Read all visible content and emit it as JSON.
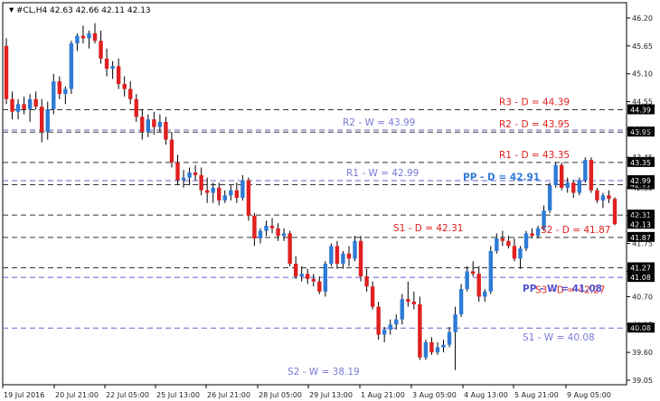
{
  "header": {
    "symbol": "#CL,H4",
    "ohlc": "42.63 42.66 42.11 42.13"
  },
  "colors": {
    "bull": "#2e7bd6",
    "bear": "#e02020",
    "daily_line": "#333333",
    "weekly_line": "#6666cc",
    "daily_label": "#e02020",
    "weekly_label": "#7a7ad8",
    "pp_daily": "#2e7bd6",
    "pp_weekly": "#5050d0"
  },
  "chart_data": {
    "type": "candlestick",
    "ylim": [
      39.05,
      46.3
    ],
    "y_ticks": [
      "46.20",
      "45.65",
      "45.10",
      "44.55",
      "44.00",
      "43.45",
      "42.85",
      "42.30",
      "41.75",
      "41.20",
      "40.70",
      "40.15",
      "39.60",
      "39.05"
    ],
    "x_ticks": [
      "19 Jul 2016",
      "20 Jul 21:00",
      "22 Jul 05:00",
      "25 Jul 13:00",
      "26 Jul 21:00",
      "28 Jul 05:00",
      "29 Jul 13:00",
      "1 Aug 21:00",
      "3 Aug 05:00",
      "4 Aug 13:00",
      "5 Aug 21:00",
      "9 Aug 05:00"
    ],
    "levels": [
      {
        "label": "R3 - D = 44.39",
        "value": 44.39,
        "kind": "daily",
        "tag": "44.39"
      },
      {
        "label": "R2 - D = 43.95",
        "value": 43.95,
        "kind": "daily",
        "tag": "43.95"
      },
      {
        "label": "R1 - D = 43.35",
        "value": 43.35,
        "kind": "daily",
        "tag": "43.35"
      },
      {
        "label": "PP - D = 42.91",
        "value": 42.91,
        "kind": "pp_daily",
        "tag": "42.91"
      },
      {
        "label": "S1 - D = 42.31",
        "value": 42.31,
        "kind": "daily",
        "tag": "42.31"
      },
      {
        "label": "S2 - D = 41.87",
        "value": 41.87,
        "kind": "daily",
        "tag": "41.87"
      },
      {
        "label": "S3 - D = 42.27",
        "value": 41.27,
        "kind": "daily",
        "tag": "41.27"
      },
      {
        "label": "R2 - W = 43.99",
        "value": 43.99,
        "kind": "weekly",
        "tag": null
      },
      {
        "label": "R1 - W = 42.99",
        "value": 42.99,
        "kind": "weekly",
        "tag": "42.99"
      },
      {
        "label": "PP - W = 41.08",
        "value": 41.08,
        "kind": "pp_weekly",
        "tag": "41.08"
      },
      {
        "label": "S1 - W = 40.08",
        "value": 40.08,
        "kind": "weekly",
        "tag": "40.08"
      },
      {
        "label": "S2 - W = 38.19",
        "value": 38.19,
        "kind": "weekly",
        "tag": null
      }
    ],
    "current_price": "42.13",
    "candles": [
      [
        45.65,
        45.8,
        44.5,
        44.6
      ],
      [
        44.6,
        44.75,
        44.2,
        44.35
      ],
      [
        44.35,
        44.6,
        44.2,
        44.5
      ],
      [
        44.5,
        44.65,
        44.3,
        44.4
      ],
      [
        44.4,
        44.7,
        44.15,
        44.6
      ],
      [
        44.6,
        44.75,
        44.4,
        44.45
      ],
      [
        44.45,
        44.6,
        43.75,
        43.95
      ],
      [
        43.95,
        44.55,
        43.8,
        44.4
      ],
      [
        44.4,
        45.1,
        44.3,
        44.95
      ],
      [
        44.95,
        45.05,
        44.6,
        44.7
      ],
      [
        44.7,
        44.85,
        44.5,
        44.8
      ],
      [
        44.8,
        45.75,
        44.7,
        45.7
      ],
      [
        45.7,
        45.9,
        45.55,
        45.85
      ],
      [
        45.85,
        46.05,
        45.7,
        45.8
      ],
      [
        45.8,
        45.95,
        45.6,
        45.9
      ],
      [
        45.9,
        46.1,
        45.7,
        45.75
      ],
      [
        45.75,
        45.95,
        45.3,
        45.4
      ],
      [
        45.4,
        45.6,
        45.05,
        45.2
      ],
      [
        45.2,
        45.35,
        45.0,
        45.25
      ],
      [
        45.25,
        45.4,
        44.8,
        44.9
      ],
      [
        44.9,
        45.05,
        44.65,
        44.8
      ],
      [
        44.8,
        44.95,
        44.5,
        44.6
      ],
      [
        44.6,
        44.7,
        44.15,
        44.25
      ],
      [
        44.25,
        44.4,
        43.8,
        43.95
      ],
      [
        43.95,
        44.3,
        43.85,
        44.2
      ],
      [
        44.2,
        44.35,
        43.9,
        44.05
      ],
      [
        44.05,
        44.3,
        43.95,
        44.15
      ],
      [
        44.15,
        44.25,
        43.7,
        43.8
      ],
      [
        43.8,
        43.95,
        43.25,
        43.35
      ],
      [
        43.35,
        43.5,
        42.9,
        43.0
      ],
      [
        43.0,
        43.2,
        42.85,
        43.05
      ],
      [
        43.05,
        43.25,
        42.9,
        43.15
      ],
      [
        43.15,
        43.3,
        43.0,
        43.1
      ],
      [
        43.1,
        43.25,
        42.7,
        42.8
      ],
      [
        42.8,
        43.05,
        42.55,
        42.75
      ],
      [
        42.75,
        42.95,
        42.55,
        42.85
      ],
      [
        42.85,
        42.95,
        42.5,
        42.6
      ],
      [
        42.6,
        42.8,
        42.55,
        42.7
      ],
      [
        42.7,
        42.9,
        42.6,
        42.8
      ],
      [
        42.8,
        42.95,
        42.55,
        42.65
      ],
      [
        42.65,
        43.1,
        42.6,
        43.0
      ],
      [
        43.0,
        43.05,
        42.2,
        42.3
      ],
      [
        42.3,
        42.35,
        41.7,
        41.85
      ],
      [
        41.85,
        42.05,
        41.75,
        42.0
      ],
      [
        42.0,
        42.2,
        41.9,
        42.1
      ],
      [
        42.1,
        42.25,
        41.95,
        42.05
      ],
      [
        42.05,
        42.15,
        41.8,
        41.9
      ],
      [
        41.9,
        42.05,
        41.8,
        41.95
      ],
      [
        41.95,
        42.0,
        41.3,
        41.35
      ],
      [
        41.35,
        41.5,
        41.05,
        41.1
      ],
      [
        41.1,
        41.3,
        41.0,
        41.15
      ],
      [
        41.15,
        41.25,
        40.95,
        41.05
      ],
      [
        41.05,
        41.15,
        40.9,
        41.0
      ],
      [
        41.0,
        41.1,
        40.75,
        40.8
      ],
      [
        40.8,
        41.4,
        40.7,
        41.35
      ],
      [
        41.35,
        41.75,
        41.3,
        41.7
      ],
      [
        41.7,
        41.8,
        41.25,
        41.35
      ],
      [
        41.35,
        41.6,
        41.25,
        41.55
      ],
      [
        41.55,
        41.7,
        41.3,
        41.45
      ],
      [
        41.45,
        41.9,
        41.4,
        41.8
      ],
      [
        41.8,
        41.9,
        41.0,
        41.1
      ],
      [
        41.1,
        41.25,
        40.8,
        40.9
      ],
      [
        40.9,
        41.0,
        40.45,
        40.5
      ],
      [
        40.5,
        40.6,
        39.85,
        39.95
      ],
      [
        39.95,
        40.1,
        39.8,
        40.05
      ],
      [
        40.05,
        40.25,
        39.95,
        40.15
      ],
      [
        40.15,
        40.35,
        40.05,
        40.25
      ],
      [
        40.25,
        40.75,
        40.15,
        40.65
      ],
      [
        40.65,
        41.0,
        40.5,
        40.6
      ],
      [
        40.6,
        40.8,
        40.45,
        40.55
      ],
      [
        40.55,
        40.7,
        39.45,
        39.5
      ],
      [
        39.5,
        39.85,
        39.45,
        39.8
      ],
      [
        39.8,
        39.9,
        39.55,
        39.6
      ],
      [
        39.6,
        39.8,
        39.55,
        39.7
      ],
      [
        39.7,
        39.85,
        39.6,
        39.75
      ],
      [
        39.75,
        40.1,
        39.7,
        40.0
      ],
      [
        40.0,
        40.5,
        39.25,
        40.35
      ],
      [
        40.35,
        40.95,
        40.3,
        40.85
      ],
      [
        40.85,
        41.3,
        40.8,
        41.2
      ],
      [
        41.2,
        41.4,
        41.1,
        41.15
      ],
      [
        41.15,
        41.3,
        40.6,
        40.7
      ],
      [
        40.7,
        40.85,
        40.6,
        40.8
      ],
      [
        40.8,
        41.7,
        40.75,
        41.6
      ],
      [
        41.6,
        41.95,
        41.55,
        41.85
      ],
      [
        41.85,
        42.0,
        41.7,
        41.8
      ],
      [
        41.8,
        41.9,
        41.65,
        41.7
      ],
      [
        41.7,
        41.85,
        41.4,
        41.45
      ],
      [
        41.45,
        41.7,
        41.25,
        41.65
      ],
      [
        41.65,
        42.0,
        41.6,
        41.95
      ],
      [
        41.95,
        42.05,
        41.85,
        41.9
      ],
      [
        41.9,
        42.1,
        41.85,
        42.05
      ],
      [
        42.05,
        42.5,
        42.0,
        42.4
      ],
      [
        42.4,
        42.95,
        42.35,
        42.9
      ],
      [
        42.9,
        43.35,
        42.85,
        43.3
      ],
      [
        43.3,
        43.35,
        42.8,
        42.85
      ],
      [
        42.85,
        43.05,
        42.75,
        42.95
      ],
      [
        42.95,
        43.0,
        42.65,
        42.75
      ],
      [
        42.75,
        43.05,
        42.7,
        43.0
      ],
      [
        43.0,
        43.45,
        42.95,
        43.4
      ],
      [
        43.4,
        43.45,
        42.75,
        42.8
      ],
      [
        42.8,
        42.85,
        42.55,
        42.6
      ],
      [
        42.6,
        42.75,
        42.45,
        42.7
      ],
      [
        42.7,
        42.8,
        42.55,
        42.63
      ],
      [
        42.63,
        42.66,
        42.11,
        42.13
      ]
    ]
  }
}
